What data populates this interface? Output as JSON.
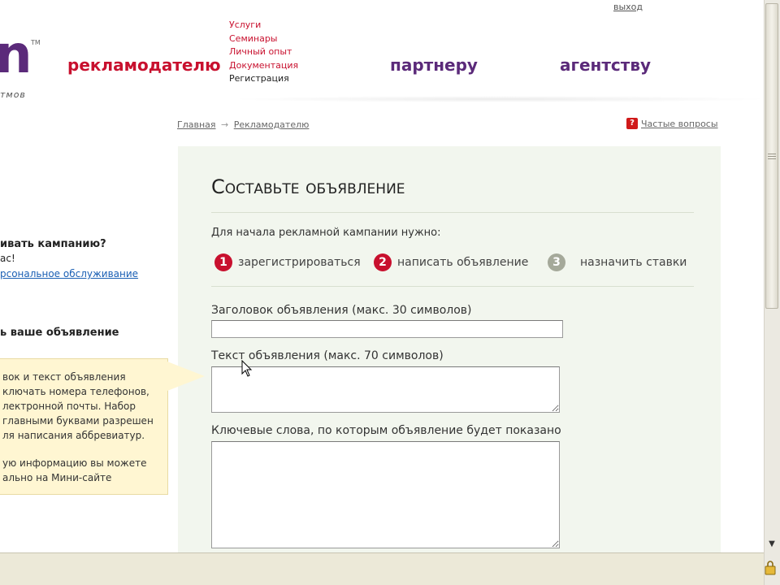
{
  "header": {
    "logo_text": "n",
    "logo_tm": "TM",
    "logo_tagline": "тмов",
    "nav": {
      "advertiser": "рекламодателю",
      "partner": "партнеру",
      "agency": "агентству"
    },
    "sub_links": [
      "Услуги",
      "Семинары",
      "Личный опыт",
      "Документация",
      "Регистрация"
    ],
    "top_right_link": "выход"
  },
  "breadcrumb": {
    "home": "Главная",
    "separator": "→",
    "current": "Рекламодателю"
  },
  "faq": {
    "icon": "?",
    "label": "Частые вопросы"
  },
  "form": {
    "title": "Составьте объявление",
    "intro": "Для начала рекламной кампании нужно:",
    "steps": [
      {
        "num": "1",
        "label": "зарегистрироваться",
        "state": "active"
      },
      {
        "num": "2",
        "label": "написать объявление",
        "state": "active"
      },
      {
        "num": "3",
        "label": "назначить ставки",
        "state": "inactive"
      }
    ],
    "fields": {
      "title_label": "Заголовок объявления (макс. 30 символов)",
      "title_value": "",
      "text_label": "Текст объявления (макс. 70 символов)",
      "text_value": "",
      "keywords_label": "Ключевые слова, по которым объявление будет показано",
      "keywords_value": ""
    }
  },
  "sidebar": {
    "question": "ивать кампанию?",
    "answer": "ас!",
    "link": "рсональное обслуживание",
    "heading": "ь ваше объявление",
    "tip_lines_1": [
      "вок и текст объявления",
      "ключать номера телефонов,",
      "лектронной почты. Набор",
      "главными буквами разрешен",
      "ля написания аббревиатур."
    ],
    "tip_lines_2": [
      "ую информацию вы можете",
      "ально на Мини-сайте"
    ]
  },
  "colors": {
    "brand_red": "#c8102e",
    "brand_purple": "#5b2a7a",
    "panel_bg": "#f2f6ee",
    "tip_bg": "#fff6d2"
  }
}
